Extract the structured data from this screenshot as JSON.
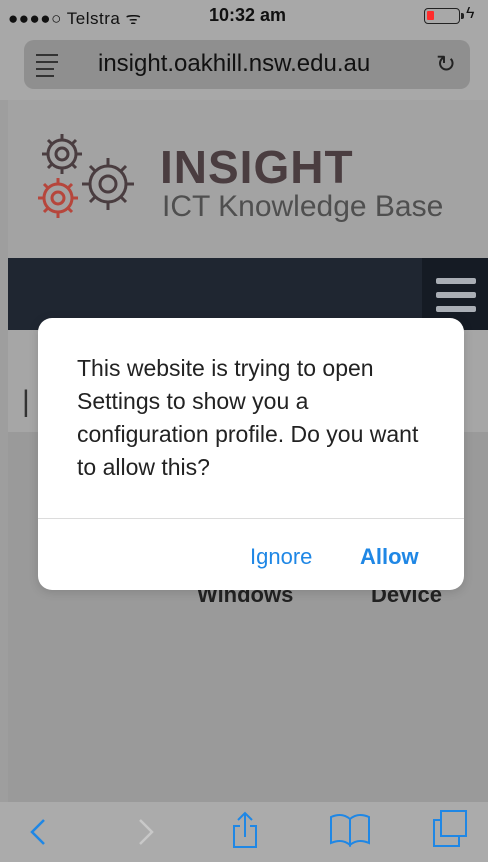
{
  "status_bar": {
    "carrier": "●●●●○ Telstra ᯤ",
    "time": "10:32 am",
    "battery_level": 0.15
  },
  "browser": {
    "url": "insight.oakhill.nsw.edu.au"
  },
  "site": {
    "title": "INSIGHT",
    "subtitle": "ICT Knowledge Base",
    "pipe": "|",
    "tile_1": "Windows",
    "tile_2": "Device"
  },
  "dialog": {
    "message": "This website is trying to open Settings to show you a configuration profile. Do you want to allow this?",
    "ignore_label": "Ignore",
    "allow_label": "Allow"
  },
  "colors": {
    "accent": "#1f87e5",
    "navbar": "#1f2631",
    "battery_low": "#ff2d2d"
  }
}
